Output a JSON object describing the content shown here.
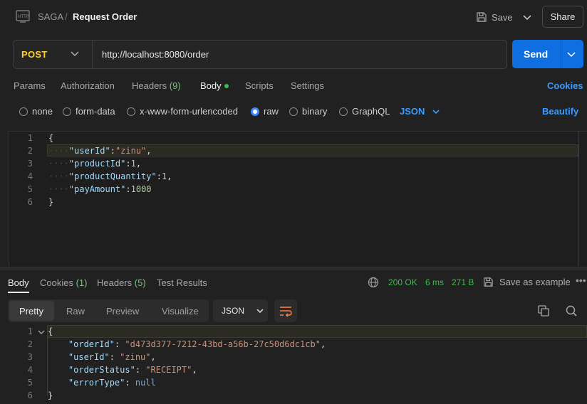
{
  "header": {
    "breadcrumb_parent": "SAGA",
    "breadcrumb_sep": "/",
    "title": "Request Order",
    "save_label": "Save",
    "share_label": "Share"
  },
  "request": {
    "method": "POST",
    "url": "http://localhost:8080/order",
    "send_label": "Send"
  },
  "request_tabs": {
    "params": "Params",
    "authorization": "Authorization",
    "headers": "Headers",
    "headers_count": "(9)",
    "body": "Body",
    "scripts": "Scripts",
    "settings": "Settings",
    "cookies": "Cookies"
  },
  "body_types": {
    "none": "none",
    "form_data": "form-data",
    "urlencoded": "x-www-form-urlencoded",
    "raw": "raw",
    "binary": "binary",
    "graphql": "GraphQL",
    "selected": "raw",
    "format": "JSON",
    "beautify": "Beautify"
  },
  "request_body": {
    "line_numbers": [
      "1",
      "2",
      "3",
      "4",
      "5",
      "6"
    ],
    "l1": "{",
    "l2_key": "\"userId\"",
    "l2_val": "\"zinu\"",
    "l3_key": "\"productId\"",
    "l3_val": "1",
    "l4_key": "\"productQuantity\"",
    "l4_val": "1",
    "l5_key": "\"payAmount\"",
    "l5_val": "1000",
    "l6": "}"
  },
  "response_tabs": {
    "body": "Body",
    "cookies": "Cookies",
    "cookies_count": "(1)",
    "headers": "Headers",
    "headers_count": "(5)",
    "test_results": "Test Results"
  },
  "response_meta": {
    "status": "200 OK",
    "time": "6 ms",
    "size": "271 B",
    "save_example": "Save as example",
    "more": "•••"
  },
  "response_view": {
    "pretty": "Pretty",
    "raw": "Raw",
    "preview": "Preview",
    "visualize": "Visualize",
    "format": "JSON"
  },
  "response_body": {
    "line_numbers": [
      "1",
      "2",
      "3",
      "4",
      "5",
      "6"
    ],
    "l1": "{",
    "l2_key": "\"orderId\"",
    "l2_val": "\"d473d377-7212-43bd-a56b-27c50d6dc1cb\"",
    "l3_key": "\"userId\"",
    "l3_val": "\"zinu\"",
    "l4_key": "\"orderStatus\"",
    "l4_val": "\"RECEIPT\"",
    "l5_key": "\"errorType\"",
    "l5_val": "null",
    "l6": "}"
  },
  "colors": {
    "accent": "#0f6fe0",
    "link": "#3d9bff",
    "method": "#ffcf33",
    "status_ok": "#3fb950"
  }
}
